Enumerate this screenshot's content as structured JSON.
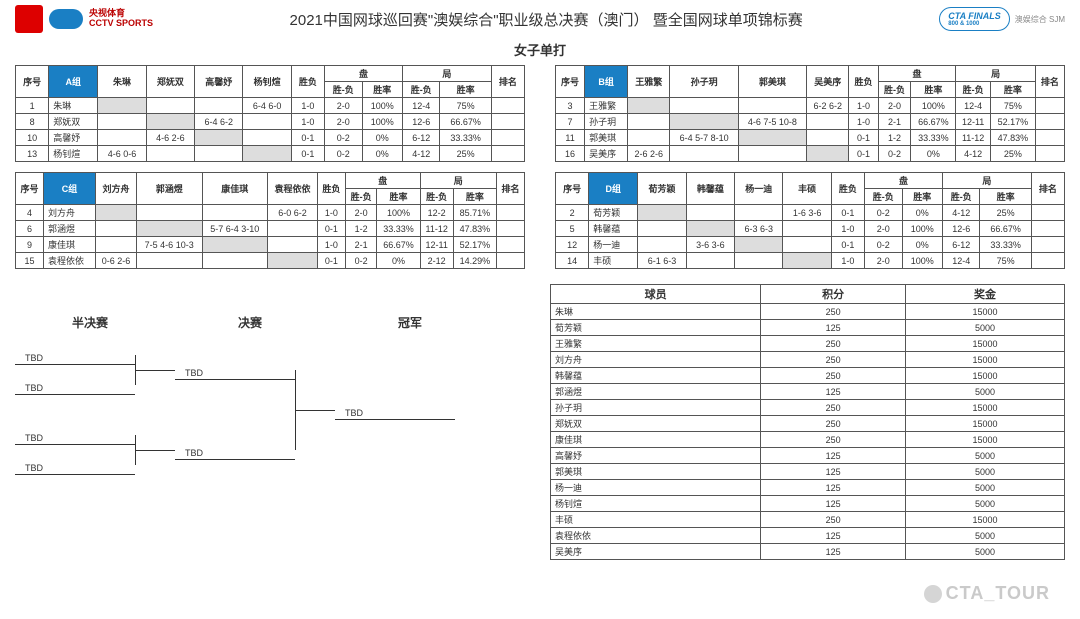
{
  "header": {
    "title": "2021中国网球巡回赛\"澳娱综合\"职业级总决赛（澳门） 暨全国网球单项锦标赛",
    "subtitle": "女子单打",
    "cctv1": "央视体育",
    "cctv2": "CCTV SPORTS",
    "finals_logo_top": "CTA FINALS",
    "finals_logo_sub": "800 & 1000",
    "sjm": "澳娱综合 SJM"
  },
  "group_cols": {
    "seq": "序号",
    "guess": "胜负",
    "pan": "盘",
    "ju": "局",
    "rank": "排名",
    "sf": "胜-负",
    "sl": "胜率"
  },
  "groups": [
    {
      "label": "A组",
      "players": [
        "朱琳",
        "郑妩双",
        "高馨妤",
        "杨钊煊"
      ],
      "rows": [
        {
          "n": "1",
          "name": "朱琳",
          "cells": [
            "",
            "",
            "",
            "6-4 6-0"
          ],
          "wl": "1-0",
          "p1": "2-0",
          "p2": "100%",
          "j1": "12-4",
          "j2": "75%",
          "rk": ""
        },
        {
          "n": "8",
          "name": "郑妩双",
          "cells": [
            "",
            "",
            "6-4 6-2",
            ""
          ],
          "wl": "1-0",
          "p1": "2-0",
          "p2": "100%",
          "j1": "12-6",
          "j2": "66.67%",
          "rk": ""
        },
        {
          "n": "10",
          "name": "高馨妤",
          "cells": [
            "",
            "4-6 2-6",
            "",
            ""
          ],
          "wl": "0-1",
          "p1": "0-2",
          "p2": "0%",
          "j1": "6-12",
          "j2": "33.33%",
          "rk": ""
        },
        {
          "n": "13",
          "name": "杨钊煊",
          "cells": [
            "4-6 0-6",
            "",
            "",
            ""
          ],
          "wl": "0-1",
          "p1": "0-2",
          "p2": "0%",
          "j1": "4-12",
          "j2": "25%",
          "rk": ""
        }
      ]
    },
    {
      "label": "B组",
      "players": [
        "王雅繁",
        "孙子玥",
        "郭美琪",
        "吴美序"
      ],
      "rows": [
        {
          "n": "3",
          "name": "王雅繁",
          "cells": [
            "",
            "",
            "",
            "6-2 6-2"
          ],
          "wl": "1-0",
          "p1": "2-0",
          "p2": "100%",
          "j1": "12-4",
          "j2": "75%",
          "rk": ""
        },
        {
          "n": "7",
          "name": "孙子玥",
          "cells": [
            "",
            "",
            "4-6 7-5 10-8",
            ""
          ],
          "wl": "1-0",
          "p1": "2-1",
          "p2": "66.67%",
          "j1": "12-11",
          "j2": "52.17%",
          "rk": ""
        },
        {
          "n": "11",
          "name": "郭美琪",
          "cells": [
            "",
            "6-4 5-7 8-10",
            "",
            ""
          ],
          "wl": "0-1",
          "p1": "1-2",
          "p2": "33.33%",
          "j1": "11-12",
          "j2": "47.83%",
          "rk": ""
        },
        {
          "n": "16",
          "name": "吴美序",
          "cells": [
            "2-6 2-6",
            "",
            "",
            ""
          ],
          "wl": "0-1",
          "p1": "0-2",
          "p2": "0%",
          "j1": "4-12",
          "j2": "25%",
          "rk": ""
        }
      ]
    },
    {
      "label": "C组",
      "players": [
        "刘方舟",
        "郭涵煜",
        "康佳琪",
        "袁程依依"
      ],
      "rows": [
        {
          "n": "4",
          "name": "刘方舟",
          "cells": [
            "",
            "",
            "",
            "6-0 6-2"
          ],
          "wl": "1-0",
          "p1": "2-0",
          "p2": "100%",
          "j1": "12-2",
          "j2": "85.71%",
          "rk": ""
        },
        {
          "n": "6",
          "name": "郭涵煜",
          "cells": [
            "",
            "",
            "5-7 6-4 3-10",
            ""
          ],
          "wl": "0-1",
          "p1": "1-2",
          "p2": "33.33%",
          "j1": "11-12",
          "j2": "47.83%",
          "rk": ""
        },
        {
          "n": "9",
          "name": "康佳琪",
          "cells": [
            "",
            "7-5 4-6 10-3",
            "",
            ""
          ],
          "wl": "1-0",
          "p1": "2-1",
          "p2": "66.67%",
          "j1": "12-11",
          "j2": "52.17%",
          "rk": ""
        },
        {
          "n": "15",
          "name": "袁程依依",
          "cells": [
            "0-6 2-6",
            "",
            "",
            ""
          ],
          "wl": "0-1",
          "p1": "0-2",
          "p2": "0%",
          "j1": "2-12",
          "j2": "14.29%",
          "rk": ""
        }
      ]
    },
    {
      "label": "D组",
      "players": [
        "荀芳颖",
        "韩馨蕴",
        "杨一迪",
        "丰硕"
      ],
      "rows": [
        {
          "n": "2",
          "name": "荀芳颖",
          "cells": [
            "",
            "",
            "",
            "1-6 3-6"
          ],
          "wl": "0-1",
          "p1": "0-2",
          "p2": "0%",
          "j1": "4-12",
          "j2": "25%",
          "rk": ""
        },
        {
          "n": "5",
          "name": "韩馨蕴",
          "cells": [
            "",
            "",
            "6-3 6-3",
            ""
          ],
          "wl": "1-0",
          "p1": "2-0",
          "p2": "100%",
          "j1": "12-6",
          "j2": "66.67%",
          "rk": ""
        },
        {
          "n": "12",
          "name": "杨一迪",
          "cells": [
            "",
            "3-6 3-6",
            "",
            ""
          ],
          "wl": "0-1",
          "p1": "0-2",
          "p2": "0%",
          "j1": "6-12",
          "j2": "33.33%",
          "rk": ""
        },
        {
          "n": "14",
          "name": "丰硕",
          "cells": [
            "6-1 6-3",
            "",
            "",
            ""
          ],
          "wl": "1-0",
          "p1": "2-0",
          "p2": "100%",
          "j1": "12-4",
          "j2": "75%",
          "rk": ""
        }
      ]
    }
  ],
  "bracket": {
    "h1": "半决赛",
    "h2": "决赛",
    "h3": "冠军",
    "tbd": "TBD"
  },
  "points_table": {
    "h_player": "球员",
    "h_points": "积分",
    "h_prize": "奖金",
    "rows": [
      {
        "name": "朱琳",
        "pts": "250",
        "prize": "15000"
      },
      {
        "name": "荀芳颖",
        "pts": "125",
        "prize": "5000"
      },
      {
        "name": "王雅繁",
        "pts": "250",
        "prize": "15000"
      },
      {
        "name": "刘方舟",
        "pts": "250",
        "prize": "15000"
      },
      {
        "name": "韩馨蕴",
        "pts": "250",
        "prize": "15000"
      },
      {
        "name": "郭涵煜",
        "pts": "125",
        "prize": "5000"
      },
      {
        "name": "孙子玥",
        "pts": "250",
        "prize": "15000"
      },
      {
        "name": "郑妩双",
        "pts": "250",
        "prize": "15000"
      },
      {
        "name": "康佳琪",
        "pts": "250",
        "prize": "15000"
      },
      {
        "name": "高馨妤",
        "pts": "125",
        "prize": "5000"
      },
      {
        "name": "郭美琪",
        "pts": "125",
        "prize": "5000"
      },
      {
        "name": "杨一迪",
        "pts": "125",
        "prize": "5000"
      },
      {
        "name": "杨钊煊",
        "pts": "125",
        "prize": "5000"
      },
      {
        "name": "丰硕",
        "pts": "250",
        "prize": "15000"
      },
      {
        "name": "袁程依依",
        "pts": "125",
        "prize": "5000"
      },
      {
        "name": "吴美序",
        "pts": "125",
        "prize": "5000"
      }
    ]
  },
  "watermark": "CTA_TOUR"
}
